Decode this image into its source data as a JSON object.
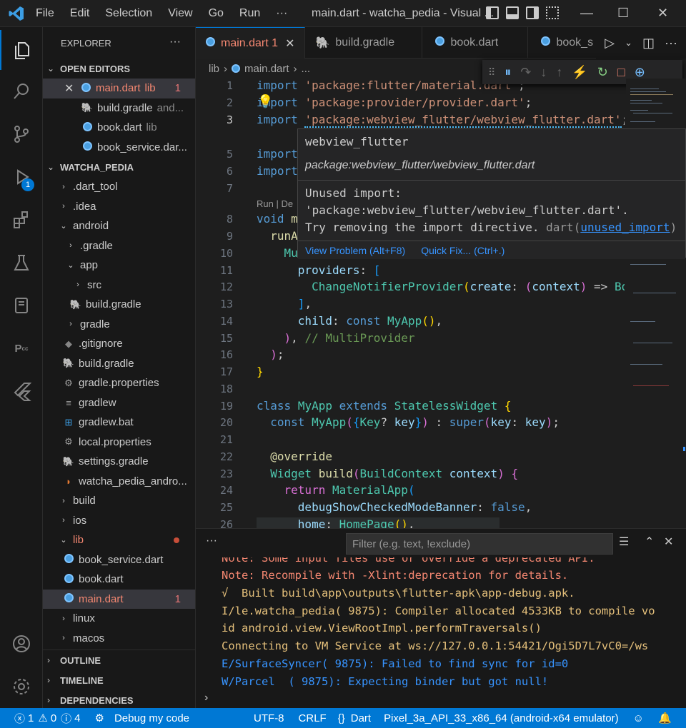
{
  "title": {
    "window": "main.dart - watcha_pedia - Visual ...",
    "menu": [
      "File",
      "Edit",
      "Selection",
      "View",
      "Go",
      "Run",
      "···"
    ]
  },
  "explorer": {
    "heading": "EXPLORER",
    "open_editors_label": "OPEN EDITORS",
    "open_editors": [
      {
        "name": "main.dart",
        "meta": "lib",
        "count": "1"
      },
      {
        "name": "build.gradle",
        "meta": "and..."
      },
      {
        "name": "book.dart",
        "meta": "lib"
      },
      {
        "name": "book_service.dar...",
        "meta": ""
      }
    ],
    "project_label": "WATCHA_PEDIA",
    "tree": [
      {
        "name": ".dart_tool",
        "chev": "›"
      },
      {
        "name": ".idea",
        "chev": "›"
      },
      {
        "name": "android",
        "chev": "⌄"
      },
      {
        "name": ".gradle",
        "chev": "›"
      },
      {
        "name": "app",
        "chev": "⌄"
      },
      {
        "name": "src",
        "chev": "›"
      },
      {
        "name": "build.gradle",
        "chev": ""
      },
      {
        "name": "gradle",
        "chev": "›"
      },
      {
        "name": ".gitignore",
        "chev": ""
      },
      {
        "name": "build.gradle",
        "chev": ""
      },
      {
        "name": "gradle.properties",
        "chev": ""
      },
      {
        "name": "gradlew",
        "chev": ""
      },
      {
        "name": "gradlew.bat",
        "chev": ""
      },
      {
        "name": "local.properties",
        "chev": ""
      },
      {
        "name": "settings.gradle",
        "chev": ""
      },
      {
        "name": "watcha_pedia_andro...",
        "chev": ""
      },
      {
        "name": "build",
        "chev": "›"
      },
      {
        "name": "ios",
        "chev": "›"
      },
      {
        "name": "lib",
        "chev": "⌄"
      },
      {
        "name": "book_service.dart",
        "chev": ""
      },
      {
        "name": "book.dart",
        "chev": ""
      },
      {
        "name": "main.dart",
        "chev": "",
        "count": "1"
      },
      {
        "name": "linux",
        "chev": "›"
      },
      {
        "name": "macos",
        "chev": "›"
      }
    ],
    "sections": [
      "OUTLINE",
      "TIMELINE",
      "DEPENDENCIES"
    ]
  },
  "tabs": [
    {
      "label": "main.dart",
      "count": "1"
    },
    {
      "label": "build.gradle"
    },
    {
      "label": "book.dart"
    },
    {
      "label": "book_s"
    }
  ],
  "breadcrumb": {
    "folder": "lib",
    "file": "main.dart",
    "more": "..."
  },
  "codelens": "Run | De",
  "hover": {
    "title": "webview_flutter",
    "path": "package:webview_flutter/webview_flutter.dart",
    "msg1": "Unused import:",
    "msg2": "'package:webview_flutter/webview_flutter.dart'.",
    "msg3": "Try removing the import directive.",
    "source": "dart(",
    "code": "unused_import",
    "close": ")",
    "action1": "View Problem (Alt+F8)",
    "action2": "Quick Fix... (Ctrl+.)"
  },
  "panel": {
    "filter_placeholder": "Filter (e.g. text, !exclude)",
    "lines": [
      {
        "text": "Note: Some input files use or override a deprecated API.",
        "color": "#f48771"
      },
      {
        "text": "Note: Recompile with -Xlint:deprecation for details.",
        "color": "#f48771"
      },
      {
        "text": "√  Built build\\app\\outputs\\flutter-apk\\app-debug.apk.",
        "color": "#e5c07b"
      },
      {
        "text": "I/le.watcha_pedia( 9875): Compiler allocated 4533KB to compile vo",
        "color": "#e5c07b"
      },
      {
        "text": "id android.view.ViewRootImpl.performTraversals()",
        "color": "#e5c07b"
      },
      {
        "text": "Connecting to VM Service at ws://127.0.0.1:54421/Ogi5D7L7vC0=/ws",
        "color": "#e5c07b"
      },
      {
        "text": "E/SurfaceSyncer( 9875): Failed to find sync for id=0",
        "color": "#3794ff"
      },
      {
        "text": "W/Parcel  ( 9875): Expecting binder but got null!",
        "color": "#3794ff"
      }
    ]
  },
  "status": {
    "errors": "1",
    "warnings": "0",
    "info": "4",
    "debug": "Debug my code",
    "encoding": "UTF-8",
    "eol": "CRLF",
    "lang": "Dart",
    "device": "Pixel_3a_API_33_x86_64 (android-x64 emulator)"
  },
  "activity_badge": "1"
}
